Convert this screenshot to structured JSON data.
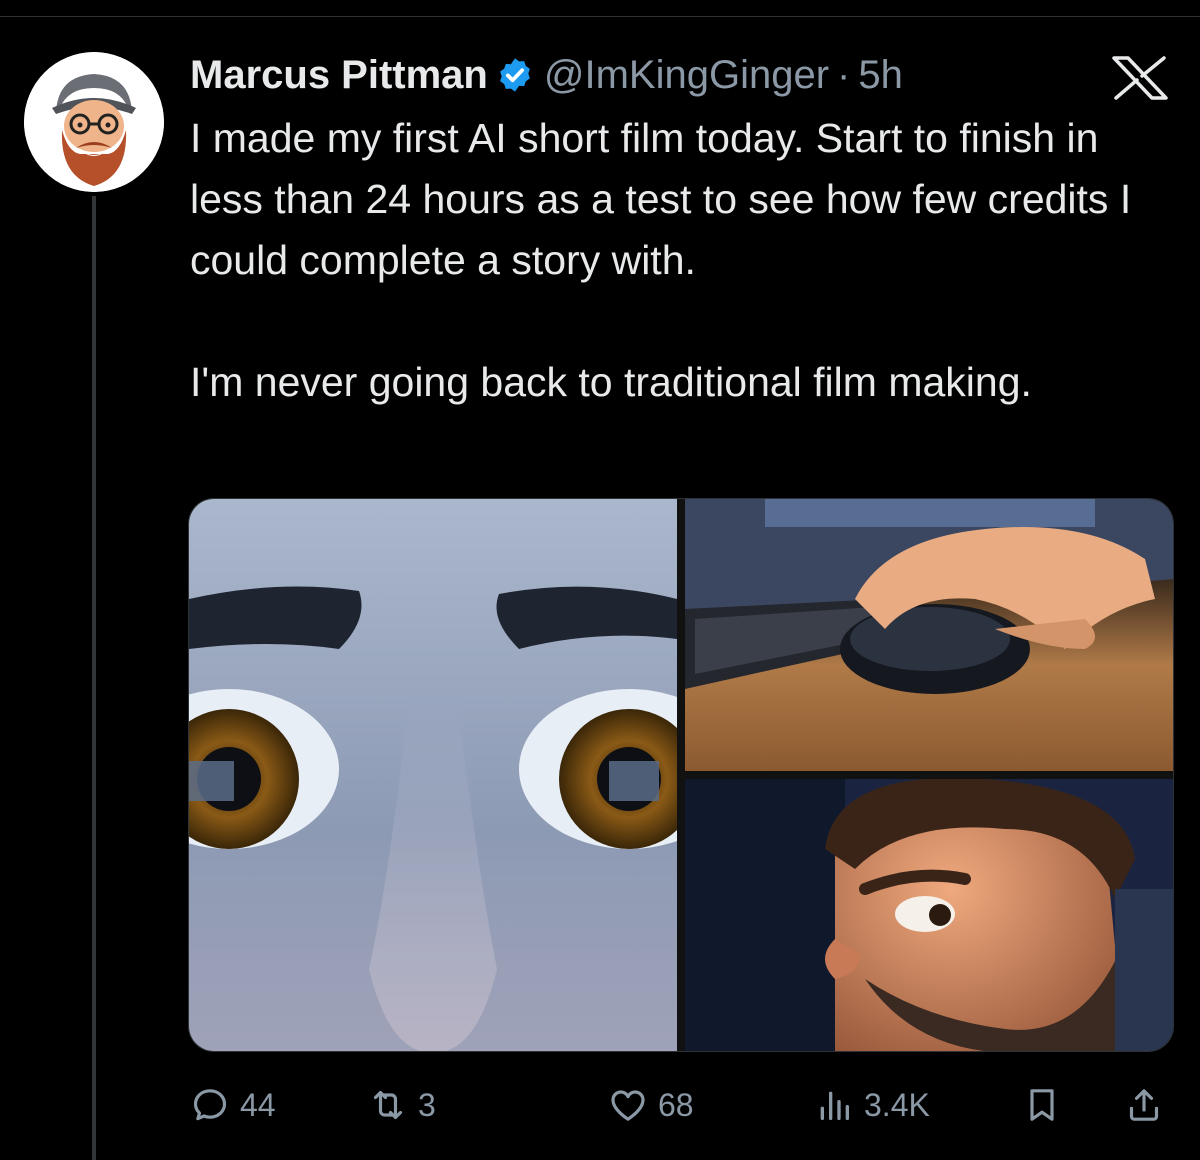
{
  "tweet": {
    "author": {
      "name": "Marcus Pittman",
      "verified": true,
      "handle": "@ImKingGinger",
      "separator": "·",
      "time": "5h",
      "avatar_icon": "bearded-man-avatar"
    },
    "close_icon": "x-logo-icon",
    "text_paragraphs": [
      "I made my first AI short film today. Start to finish in less than 24 hours as a test to see how few credits I could complete a story with.",
      "I'm never going back to traditional film making."
    ],
    "media": [
      {
        "name": "close-up-eyes-image"
      },
      {
        "name": "hand-on-mouse-image"
      },
      {
        "name": "man-side-glance-image"
      }
    ],
    "actions": {
      "replies": "44",
      "reposts": "3",
      "likes": "68",
      "views": "3.4K"
    }
  },
  "colors": {
    "background": "#000000",
    "text": "#e7e9ea",
    "muted": "#8b98a5",
    "verified": "#1d9bf0"
  }
}
